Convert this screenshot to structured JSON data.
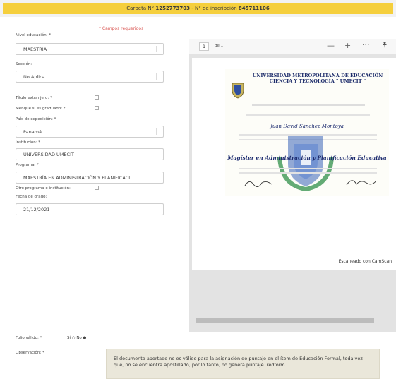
{
  "banner": {
    "prefix": "Carpeta N°",
    "carpeta": "1252773703",
    "middle": "- N° de inscripción",
    "inscripcion": "845711106"
  },
  "required_note": "* Campos requeridos",
  "form": {
    "nivel_label": "Nivel educación: *",
    "nivel_value": "MAESTRIA",
    "sección_label": "Sección:",
    "sección_value": "No Aplica",
    "titulo_ext_label": "Título extranjero: *",
    "menque_label": "Menque si es graduado: *",
    "pais_label": "País de expedición: *",
    "pais_value": "Panamá",
    "institucion_label": "Institución: *",
    "institucion_value": "UNIVERSIDAD UMECIT",
    "programa_label": "Programa: *",
    "programa_value": "MAESTRÍA EN ADMINISTRACIÓN Y PLANIFICACI",
    "otro_label": "Otro programa o institución:",
    "fecha_label": "Fecha de grado:",
    "fecha_value": "21/12/2021"
  },
  "viewer": {
    "page_number": "1",
    "page_of": "de 1",
    "minus_icon": "minus-icon",
    "plus_icon": "plus-icon",
    "more_icon": "more-icon",
    "pin_icon": "pin-icon",
    "scanned_label": "Escaneado con CamScan",
    "certificate": {
      "title_line1": "UNIVERSIDAD METROPOLITANA DE EDUCACIÓN",
      "title_line2": "CIENCIA Y TECNOLOGÍA \" UMECIT \"",
      "name": "Juan David Sánchez Montoya",
      "degree": "Magíster en Administración y Planificación Educativa"
    }
  },
  "bottom": {
    "folio_label": "Folio válido: *",
    "folio_value": "Sí ○ No ●",
    "observacion_label": "Observación: *",
    "observacion_text": "El documento aportado no es válido para la asignación de puntaje en el ítem de Educación Formal, toda vez que, no se encuentra apostillado, por lo tanto, no genera puntaje. redform."
  },
  "colors": {
    "banner": "#f5cf3d",
    "required": "#d9534f",
    "observation_bg": "#eae7da"
  }
}
